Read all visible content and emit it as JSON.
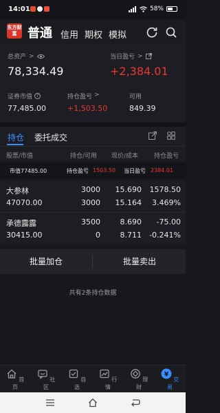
{
  "status_bar": {
    "time": "14:01",
    "battery": "58%",
    "battery_level": 0.58,
    "app_icon_colors": [
      "#e14b2f",
      "#f0f0f0",
      "#e84c3d"
    ]
  },
  "header": {
    "logo_text": "东方财富",
    "title": "普通",
    "tabs": [
      "信用",
      "期权",
      "模拟"
    ],
    "refresh_icon": "refresh-icon",
    "search_icon": "search-icon"
  },
  "account": {
    "total_assets_label": "总资产",
    "total_assets": "78,334.49",
    "daily_pnl_label": "当日盈亏",
    "daily_pnl": "+2,384.01",
    "market_value_label": "证券市值",
    "market_value": "77,485.00",
    "position_pnl_label": "持仓盈亏",
    "position_pnl": "+1,503.50",
    "available_label": "可用",
    "available": "849.39"
  },
  "position_tabs": {
    "holding": "持仓",
    "orders": "委托成交"
  },
  "columns": {
    "stock": "股票/市值",
    "qty": "持仓/可用",
    "price": "现价/成本",
    "pnl": "持仓盈亏"
  },
  "summary": {
    "market_value": "市值77485.00",
    "position_pnl_label": "持仓盈亏",
    "position_pnl": "1503.50",
    "daily_pnl_label": "当日盈亏",
    "daily_pnl": "2384.01"
  },
  "holdings": [
    {
      "name": "大参林",
      "market_value": "47070.00",
      "qty": "3000",
      "available": "3000",
      "price": "15.690",
      "cost": "15.164",
      "pnl": "1578.50",
      "pnl_pct": "3.469%",
      "trend": "up"
    },
    {
      "name": "承德露露",
      "market_value": "30415.00",
      "qty": "3500",
      "available": "0",
      "price": "8.690",
      "cost": "8.711",
      "pnl": "-75.00",
      "pnl_pct": "-0.241%",
      "trend": "down"
    }
  ],
  "actions": {
    "batch_buy": "批量加仓",
    "batch_sell": "批量卖出"
  },
  "note": "共有2条持仓数据",
  "bottom_nav": [
    {
      "label": "首页",
      "icon": "home-icon"
    },
    {
      "label": "社区",
      "icon": "community-icon"
    },
    {
      "label": "自选",
      "icon": "watchlist-icon"
    },
    {
      "label": "行情",
      "icon": "market-icon"
    },
    {
      "label": "理财",
      "icon": "finance-icon"
    },
    {
      "label": "交易",
      "icon": "trade-icon"
    }
  ],
  "colors": {
    "accent": "#3a8dff",
    "up": "#f0342f",
    "down": "#1fbd5a"
  }
}
